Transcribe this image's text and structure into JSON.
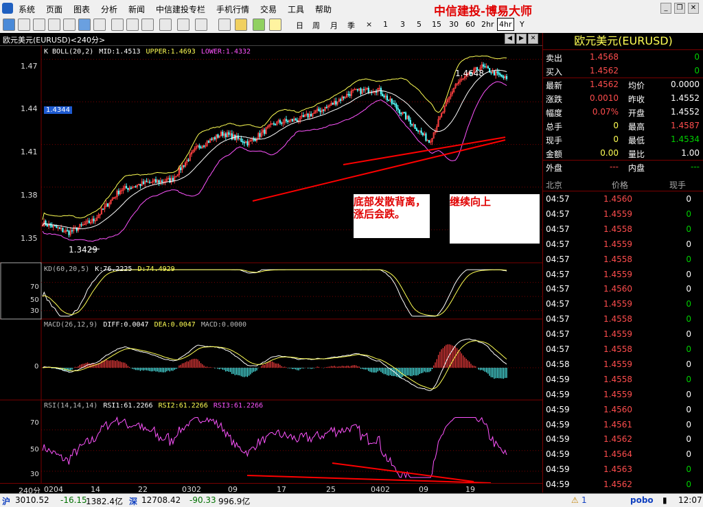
{
  "menu": {
    "items": [
      "系统",
      "页面",
      "图表",
      "分析",
      "新闻",
      "中信建投专栏",
      "手机行情",
      "交易",
      "工具",
      "帮助"
    ],
    "brand": "中信建投-博易大师"
  },
  "toolbar": {
    "periods": [
      "日",
      "周",
      "月",
      "季",
      "×",
      "1",
      "3",
      "5",
      "15",
      "30",
      "60",
      "2hr",
      "4hr",
      "Y"
    ],
    "active_period": "4hr"
  },
  "chart": {
    "title": "欧元美元(EURUSD)<240分>",
    "boll_info": {
      "name": "K  BOLL(20,2)",
      "mid": "MID:1.4513",
      "upper": "UPPER:1.4693",
      "lower": "LOWER:1.4332"
    },
    "kd_info": {
      "name": "KD(60,20,5)",
      "k": "K:76.2225",
      "d": "D:74.4929"
    },
    "macd_info": {
      "name": "MACD(26,12,9)",
      "diff": "DIFF:0.0047",
      "dea": "DEA:0.0047",
      "macd": "MACD:0.0000"
    },
    "rsi_info": {
      "name": "RSI(14,14,14)",
      "rsi1": "RSI1:61.2266",
      "rsi2": "RSI2:61.2266",
      "rsi3": "RSI3:61.2266"
    },
    "price_axis": [
      "1.47",
      "1.44",
      "1.41",
      "1.38",
      "1.35"
    ],
    "kd_axis": [
      "70",
      "50",
      "30"
    ],
    "macd_axis": [
      "0"
    ],
    "rsi_axis": [
      "70",
      "50",
      "30"
    ],
    "current_price": "1.4344",
    "high_label": "1.4648",
    "low_label": "1.3429",
    "annotation1": "底部发散背离，涨后会跌。",
    "annotation2": "继续向上",
    "x_axis_unit": "240分",
    "x_axis": [
      "0204",
      "14",
      "22",
      "0302",
      "09",
      "17",
      "25",
      "0402",
      "09",
      "19"
    ],
    "colors": {
      "up": "#ff4040",
      "down": "#54ffff",
      "upper": "#ffff54",
      "mid": "#ffffff",
      "lower": "#ff54ff",
      "trend": "#ff0000"
    }
  },
  "chart_data": [
    {
      "type": "candlestick",
      "title": "欧元美元(EURUSD)<240分>",
      "ylim": [
        1.335,
        1.475
      ],
      "x": [
        "0204",
        "14",
        "22",
        "0302",
        "09",
        "17",
        "25",
        "0402",
        "09",
        "19"
      ],
      "close": [
        1.355,
        1.348,
        1.357,
        1.378,
        1.383,
        1.385,
        1.408,
        1.418,
        1.411,
        1.425,
        1.428,
        1.436,
        1.447,
        1.449,
        1.431,
        1.412,
        1.452,
        1.465,
        1.456
      ],
      "series": [
        {
          "name": "MID",
          "last": 1.4513
        },
        {
          "name": "UPPER",
          "last": 1.4693
        },
        {
          "name": "LOWER",
          "last": 1.4332
        }
      ]
    },
    {
      "type": "line",
      "title": "KD(60,20,5)",
      "ylim": [
        20,
        90
      ],
      "series": [
        {
          "name": "K",
          "last": 76.2225
        },
        {
          "name": "D",
          "last": 74.4929
        }
      ]
    },
    {
      "type": "bar",
      "title": "MACD(26,12,9)",
      "series": [
        {
          "name": "DIFF",
          "last": 0.0047
        },
        {
          "name": "DEA",
          "last": 0.0047
        },
        {
          "name": "MACD",
          "last": 0.0
        }
      ]
    },
    {
      "type": "line",
      "title": "RSI(14,14,14)",
      "ylim": [
        20,
        85
      ],
      "series": [
        {
          "name": "RSI1",
          "last": 61.2266
        },
        {
          "name": "RSI2",
          "last": 61.2266
        },
        {
          "name": "RSI3",
          "last": 61.2266
        }
      ]
    }
  ],
  "quote": {
    "title": "欧元美元(EURUSD)",
    "rows": [
      {
        "l1": "卖出",
        "v1": "1.4568",
        "c1": "red",
        "v2": "0",
        "c2": "green"
      },
      {
        "l1": "买入",
        "v1": "1.4562",
        "c1": "red",
        "v2": "0",
        "c2": "green"
      },
      {
        "l1": "最新",
        "v1": "1.4562",
        "c1": "red",
        "l2": "均价",
        "v2": "0.0000",
        "c2": "white"
      },
      {
        "l1": "涨跌",
        "v1": "0.0010",
        "c1": "red",
        "l2": "昨收",
        "v2": "1.4552",
        "c2": "white"
      },
      {
        "l1": "幅度",
        "v1": "0.07%",
        "c1": "red",
        "l2": "开盘",
        "v2": "1.4552",
        "c2": "white"
      },
      {
        "l1": "总手",
        "v1": "0",
        "c1": "yellow",
        "l2": "最高",
        "v2": "1.4587",
        "c2": "red"
      },
      {
        "l1": "现手",
        "v1": "0",
        "c1": "yellow",
        "l2": "最低",
        "v2": "1.4534",
        "c2": "green"
      },
      {
        "l1": "金额",
        "v1": "0.00",
        "c1": "yellow",
        "l2": "量比",
        "v2": "1.00",
        "c2": "white"
      },
      {
        "l1": "外盘",
        "v1": "---",
        "c1": "red",
        "l2": "内盘",
        "v2": "---",
        "c2": "green"
      }
    ],
    "trades_header": {
      "time": "北京",
      "price": "价格",
      "qty": "现手"
    },
    "trades": [
      {
        "t": "04:57",
        "p": "1.4560",
        "q": "0",
        "qc": "white"
      },
      {
        "t": "04:57",
        "p": "1.4559",
        "q": "0",
        "qc": "green"
      },
      {
        "t": "04:57",
        "p": "1.4558",
        "q": "0",
        "qc": "green"
      },
      {
        "t": "04:57",
        "p": "1.4559",
        "q": "0",
        "qc": "white"
      },
      {
        "t": "04:57",
        "p": "1.4558",
        "q": "0",
        "qc": "green"
      },
      {
        "t": "04:57",
        "p": "1.4559",
        "q": "0",
        "qc": "white"
      },
      {
        "t": "04:57",
        "p": "1.4560",
        "q": "0",
        "qc": "white"
      },
      {
        "t": "04:57",
        "p": "1.4559",
        "q": "0",
        "qc": "green"
      },
      {
        "t": "04:57",
        "p": "1.4558",
        "q": "0",
        "qc": "green"
      },
      {
        "t": "04:57",
        "p": "1.4559",
        "q": "0",
        "qc": "white"
      },
      {
        "t": "04:57",
        "p": "1.4558",
        "q": "0",
        "qc": "green"
      },
      {
        "t": "04:58",
        "p": "1.4559",
        "q": "0",
        "qc": "white"
      },
      {
        "t": "04:59",
        "p": "1.4558",
        "q": "0",
        "qc": "green"
      },
      {
        "t": "04:59",
        "p": "1.4559",
        "q": "0",
        "qc": "white"
      },
      {
        "t": "04:59",
        "p": "1.4560",
        "q": "0",
        "qc": "white"
      },
      {
        "t": "04:59",
        "p": "1.4561",
        "q": "0",
        "qc": "white"
      },
      {
        "t": "04:59",
        "p": "1.4562",
        "q": "0",
        "qc": "white"
      },
      {
        "t": "04:59",
        "p": "1.4564",
        "q": "0",
        "qc": "white"
      },
      {
        "t": "04:59",
        "p": "1.4563",
        "q": "0",
        "qc": "green"
      },
      {
        "t": "04:59",
        "p": "1.4562",
        "q": "0",
        "qc": "green"
      }
    ]
  },
  "status": {
    "sh_label": "沪",
    "sh_index": "3010.52",
    "sh_change": "-16.15",
    "sh_amount": "1382.4亿",
    "sz_label": "深",
    "sz_index": "12708.42",
    "sz_change": "-90.33",
    "sz_amount": "996.9亿",
    "alert": "1",
    "pobo": "pobo",
    "time": "12:07"
  }
}
